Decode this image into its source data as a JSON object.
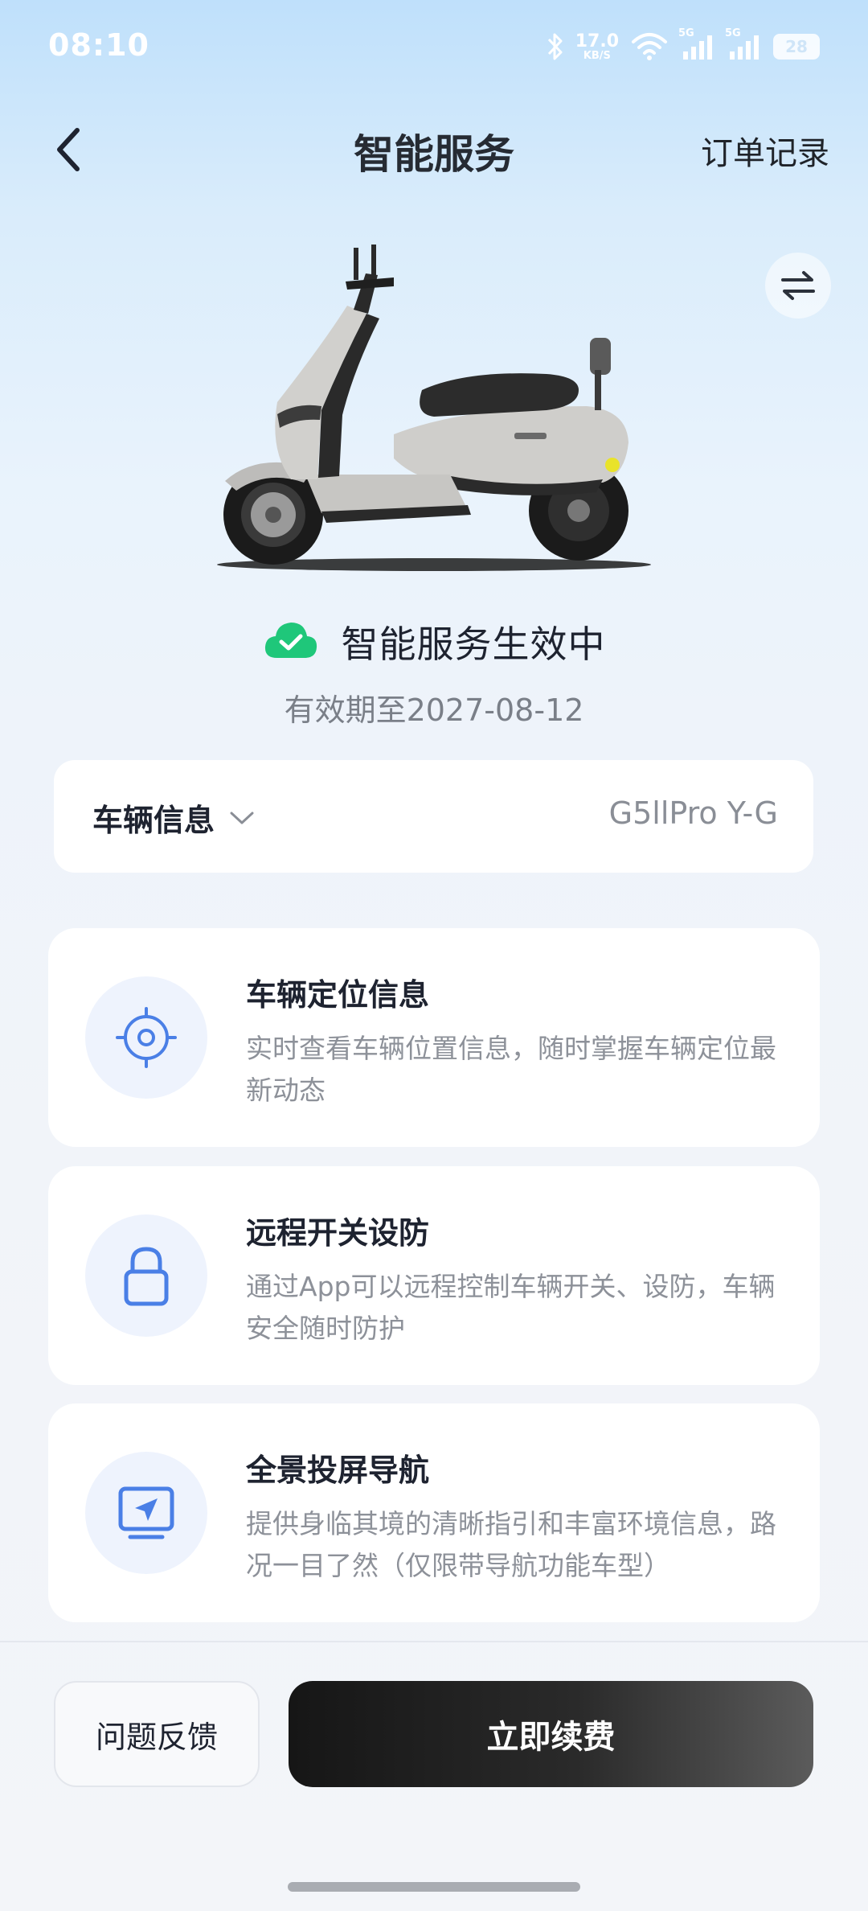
{
  "status_bar": {
    "time": "08:10",
    "net_speed_value": "17.0",
    "net_speed_unit": "KB/S",
    "signal_1_label": "5G",
    "signal_2_label": "5G",
    "battery_level": "28"
  },
  "header": {
    "title": "智能服务",
    "order_link": "订单记录"
  },
  "service_status": {
    "text": "智能服务生效中",
    "validity": "有效期至2027-08-12"
  },
  "vehicle": {
    "label": "车辆信息",
    "model": "G5llPro Y-G"
  },
  "services": [
    {
      "title": "车辆定位信息",
      "description": "实时查看车辆位置信息，随时掌握车辆定位最新动态"
    },
    {
      "title": "远程开关设防",
      "description": "通过App可以远程控制车辆开关、设防，车辆安全随时防护"
    },
    {
      "title": "全景投屏导航",
      "description": "提供身临其境的清晰指引和丰富环境信息，路况一目了然（仅限带导航功能车型）"
    }
  ],
  "footer": {
    "feedback_label": "问题反馈",
    "renew_label": "立即续费"
  },
  "colors": {
    "accent_blue": "#4a7fe6",
    "success_green": "#1fc77a",
    "primary_dark": "#1a1a1a"
  }
}
